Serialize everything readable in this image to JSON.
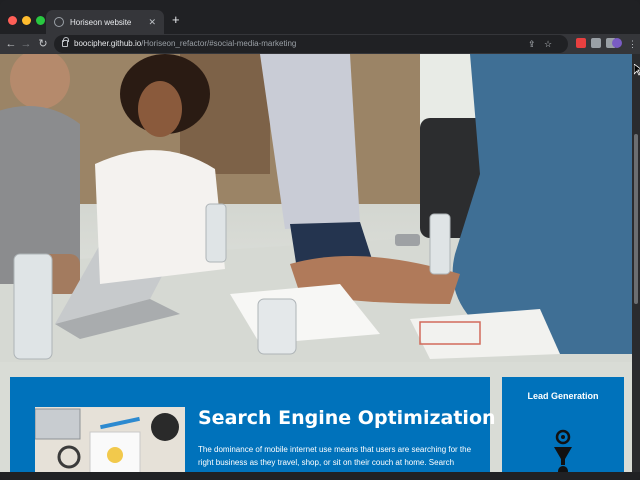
{
  "browser": {
    "traffic_lights": [
      "#ff5f57",
      "#febc2e",
      "#28c840"
    ],
    "tab": {
      "title": "Horiseon website",
      "close": "✕"
    },
    "new_tab": "+",
    "nav": {
      "back": "←",
      "forward": "→",
      "reload": "↻"
    },
    "address": {
      "host": "boocipher.github.io",
      "path": "/Horiseon_refactor/#social-media-marketing"
    },
    "omnibox_icons": [
      "share-icon",
      "bookmark-star-icon"
    ],
    "extensions": [
      "extension-icon",
      "puzzle-icon",
      "reading-list-icon",
      "profile-avatar",
      "menu-icon"
    ],
    "extension_colors": [
      "#e84040",
      "#9aa0a6",
      "#9aa0a6",
      "#7a5cc4"
    ]
  },
  "page": {
    "seo": {
      "title": "Search Engine Optimization",
      "text": "The dominance of mobile internet use means that users are searching for the right business as they travel, shop, or sit on their couch at home. Search Engine"
    },
    "lead": {
      "title": "Lead Generation"
    }
  }
}
